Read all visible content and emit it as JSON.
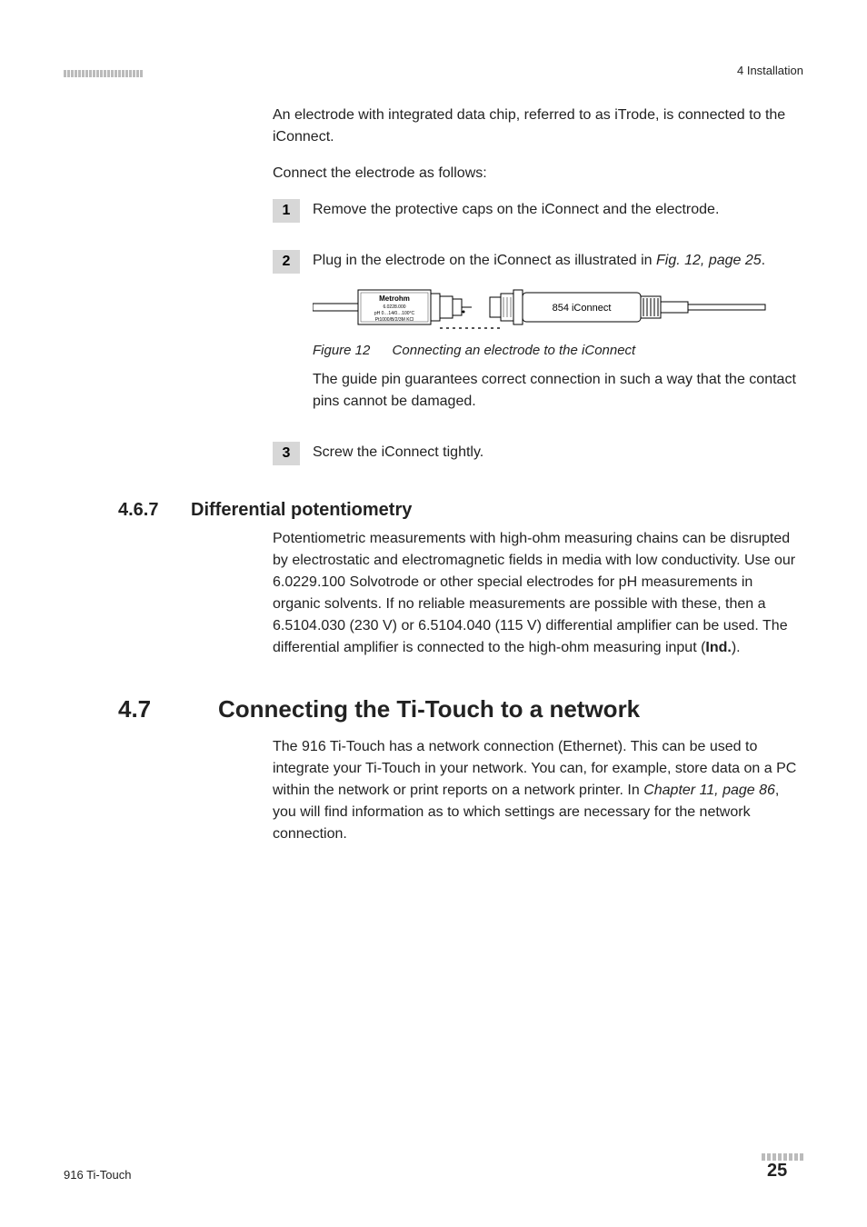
{
  "header": {
    "chapter_ref": "4 Installation"
  },
  "intro": {
    "p1": "An electrode with integrated data chip, referred to as iTrode, is connected to the iConnect.",
    "p2": "Connect the electrode as follows:"
  },
  "steps": {
    "s1": {
      "num": "1",
      "text": "Remove the protective caps on the iConnect and the electrode."
    },
    "s2": {
      "num": "2",
      "text_a": "Plug in the electrode on the iConnect as illustrated in ",
      "link": "Fig. 12, page 25",
      "text_b": ".",
      "after_fig": "The guide pin guarantees correct connection in such a way that the contact pins cannot be damaged."
    },
    "s3": {
      "num": "3",
      "text": "Screw the iConnect tightly."
    }
  },
  "figure": {
    "num": "Figure 12",
    "caption": "Connecting an electrode to the iConnect",
    "labels": {
      "brand": "Metrohm",
      "l1": "6.0228.000",
      "l2": "pH 0…14/0…100°C",
      "l3": "Pt1000/B/2/3M KCl",
      "iconnect": "854 iConnect"
    }
  },
  "sec467": {
    "num": "4.6.7",
    "title": "Differential potentiometry",
    "body_a": "Potentiometric measurements with high-ohm measuring chains can be disrupted by electrostatic and electromagnetic fields in media with low conductivity. Use our 6.0229.100 Solvotrode or other special electrodes for pH measurements in organic solvents. If no reliable measurements are possible with these, then a 6.5104.030 (230 V) or 6.5104.040 (115 V) differential amplifier can be used. The differential amplifier is connected to the high-ohm measuring input (",
    "body_b": "Ind.",
    "body_c": ")."
  },
  "sec47": {
    "num": "4.7",
    "title": "Connecting the Ti-Touch to a network",
    "body_a": "The 916 Ti-Touch has a network connection (Ethernet). This can be used to integrate your Ti-Touch in your network. You can, for example, store data on a PC within the network or print reports on a network printer. In ",
    "link": "Chapter 11, page 86",
    "body_b": ", you will find information as to which settings are necessary for the network connection."
  },
  "footer": {
    "product": "916 Ti-Touch",
    "page": "25"
  }
}
